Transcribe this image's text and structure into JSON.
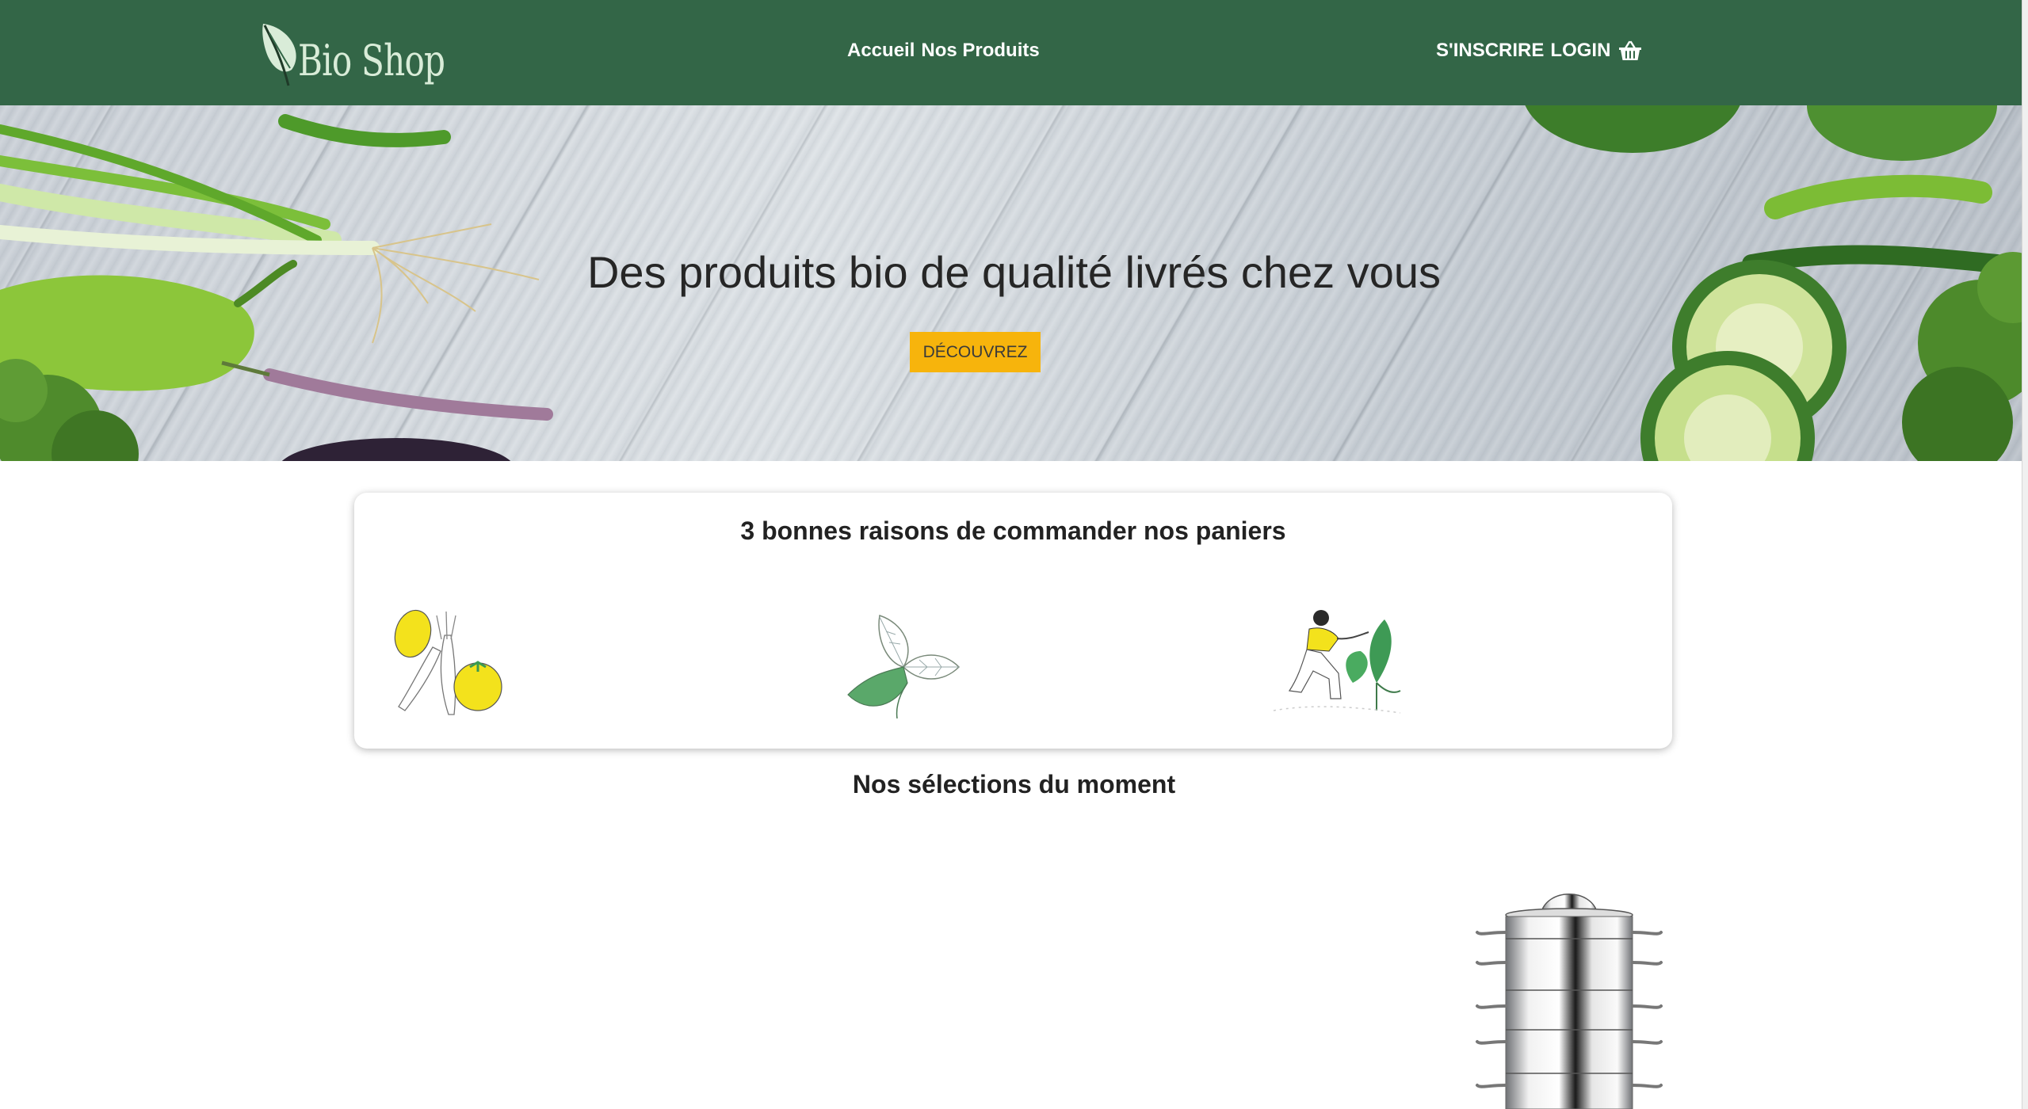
{
  "header": {
    "logo_text": "Bio Shop",
    "logo_icon": "leaf-icon",
    "nav_center": [
      "Accueil",
      "Nos Produits"
    ],
    "nav_right": [
      "S'INSCRIRE",
      "LOGIN"
    ],
    "basket_icon": "basket-icon",
    "background_color": "#336647"
  },
  "hero": {
    "title": "Des produits bio de qualité livrés chez vous",
    "button_label": "DÉCOUVREZ",
    "button_color": "#f7b40c"
  },
  "reasons": {
    "title": "3 bonnes raisons de commander nos paniers",
    "illustrations": [
      "vegetables-illustration",
      "leaves-illustration",
      "gardener-illustration"
    ]
  },
  "selections": {
    "title": "Nos sélections du moment",
    "product_image": "steamer-pot-image"
  }
}
